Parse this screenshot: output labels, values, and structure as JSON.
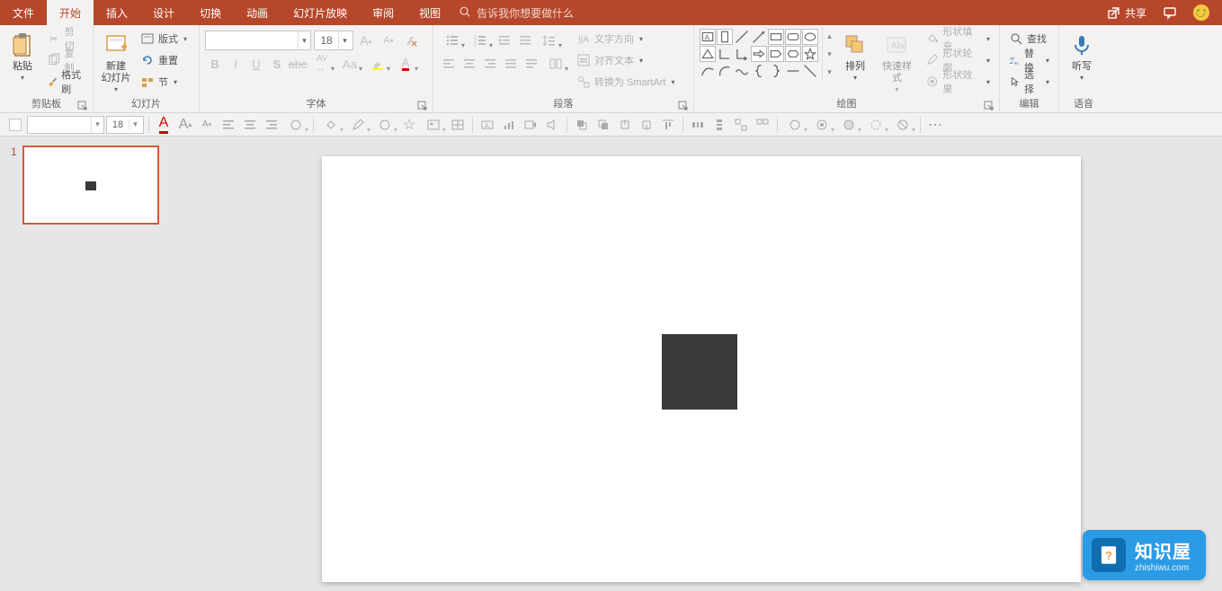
{
  "tabs": {
    "file": "文件",
    "home": "开始",
    "insert": "插入",
    "design": "设计",
    "transition": "切换",
    "animation": "动画",
    "slideshow": "幻灯片放映",
    "review": "审阅",
    "view": "视图",
    "tellme": "告诉我你想要做什么"
  },
  "titlebar_right": {
    "share": "共享"
  },
  "ribbon": {
    "clipboard": {
      "label": "剪贴板",
      "paste": "粘贴",
      "cut": "剪切",
      "copy": "复制",
      "format_painter": "格式刷"
    },
    "slides": {
      "label": "幻灯片",
      "new_slide": "新建\n幻灯片",
      "layout": "版式",
      "reset": "重置",
      "section": "节"
    },
    "font": {
      "label": "字体",
      "size": "18"
    },
    "paragraph": {
      "label": "段落",
      "text_direction": "文字方向",
      "align_text": "对齐文本",
      "convert_smartart": "转换为 SmartArt"
    },
    "drawing": {
      "label": "绘图",
      "arrange": "排列",
      "quick_styles": "快速样式",
      "shape_fill": "形状填充",
      "shape_outline": "形状轮廓",
      "shape_effects": "形状效果"
    },
    "editing": {
      "label": "编辑",
      "find": "查找",
      "replace": "替换",
      "select": "选择"
    },
    "voice": {
      "label": "语音",
      "dictate": "听写"
    }
  },
  "toolbar2": {
    "font_size": "18"
  },
  "thumbs": {
    "num1": "1"
  },
  "watermark": {
    "title": "知识屋",
    "url": "zhishiwu.com"
  }
}
